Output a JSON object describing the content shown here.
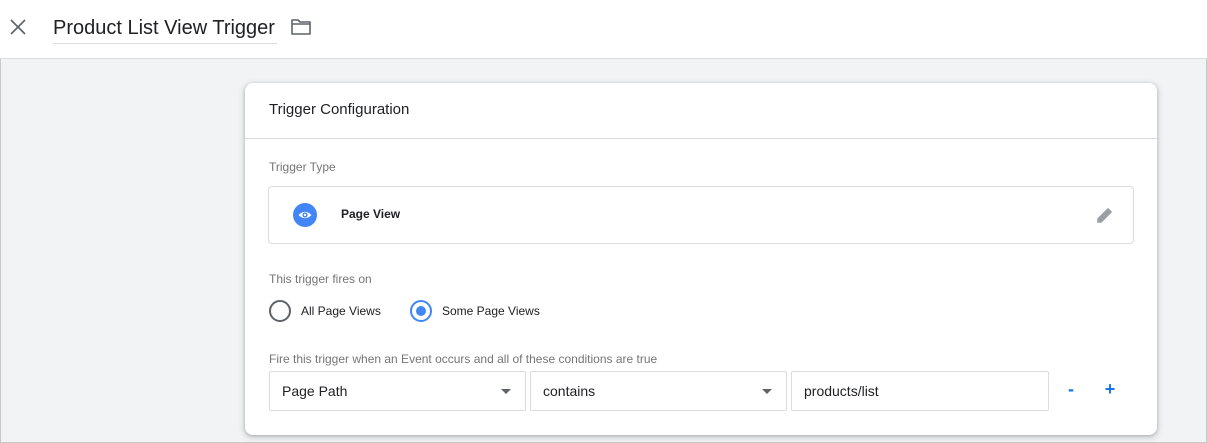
{
  "header": {
    "title": "Product List View Trigger",
    "close_icon": "close-icon",
    "folder_icon": "folder-icon"
  },
  "card": {
    "title": "Trigger Configuration",
    "trigger_type": {
      "label": "Trigger Type",
      "name": "Page View",
      "icon": "eye-icon",
      "icon_color": "#4285f4",
      "edit_icon": "pencil-icon"
    },
    "fires_on": {
      "label": "This trigger fires on",
      "options": [
        {
          "label": "All Page Views",
          "selected": false
        },
        {
          "label": "Some Page Views",
          "selected": true
        }
      ]
    },
    "condition": {
      "label": "Fire this trigger when an Event occurs and all of these conditions are true",
      "variable": "Page Path",
      "operator": "contains",
      "value": "products/list",
      "remove_label": "-",
      "add_label": "+"
    }
  },
  "colors": {
    "accent": "#4285f4",
    "link": "#1a73e8",
    "background": "#f1f3f4"
  }
}
